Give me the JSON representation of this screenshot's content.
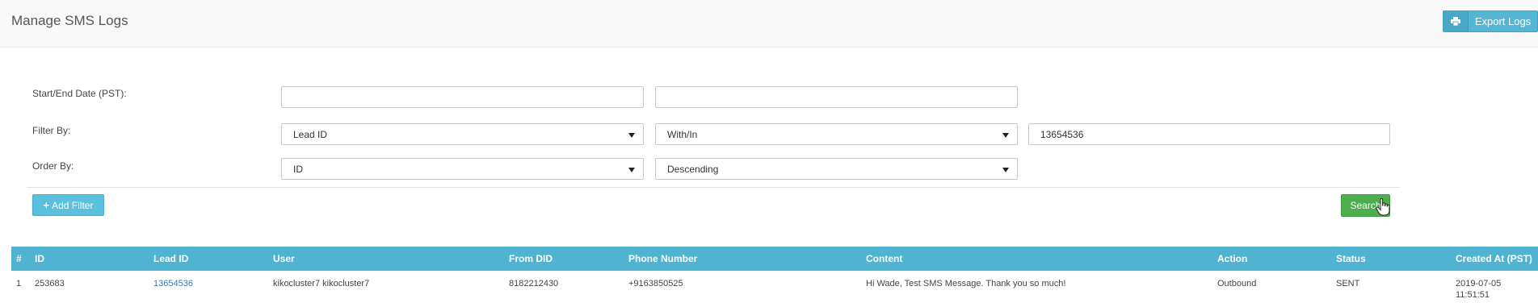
{
  "header": {
    "title": "Manage SMS Logs",
    "export_label": "Export Logs",
    "export_icon": "printer-icon"
  },
  "filters": {
    "date_label": "Start/End Date (PST):",
    "start_date": "",
    "end_date": "",
    "filter_by_label": "Filter By:",
    "filter_field": "Lead ID",
    "filter_operator": "With/In",
    "filter_value": "13654536",
    "order_by_label": "Order By:",
    "order_field": "ID",
    "order_direction": "Descending",
    "add_filter_label": "Add Filter",
    "search_label": "Search"
  },
  "table": {
    "columns": [
      "#",
      "ID",
      "Lead ID",
      "User",
      "From DID",
      "Phone Number",
      "Content",
      "Action",
      "Status",
      "Created At (PST)"
    ],
    "rows": [
      {
        "num": "1",
        "id": "253683",
        "lead_id": "13654536",
        "user": "kikocluster7 kikocluster7",
        "from_did": "8182212430",
        "phone": "+9163850525",
        "content": "Hi Wade, Test SMS Message. Thank you so much!",
        "action": "Outbound",
        "status": "SENT",
        "created_date": "2019-07-05",
        "created_time": "11:51:51"
      }
    ]
  },
  "colors": {
    "accent": "#4fb3d1",
    "success": "#4cae4c",
    "link": "#337ab7"
  }
}
